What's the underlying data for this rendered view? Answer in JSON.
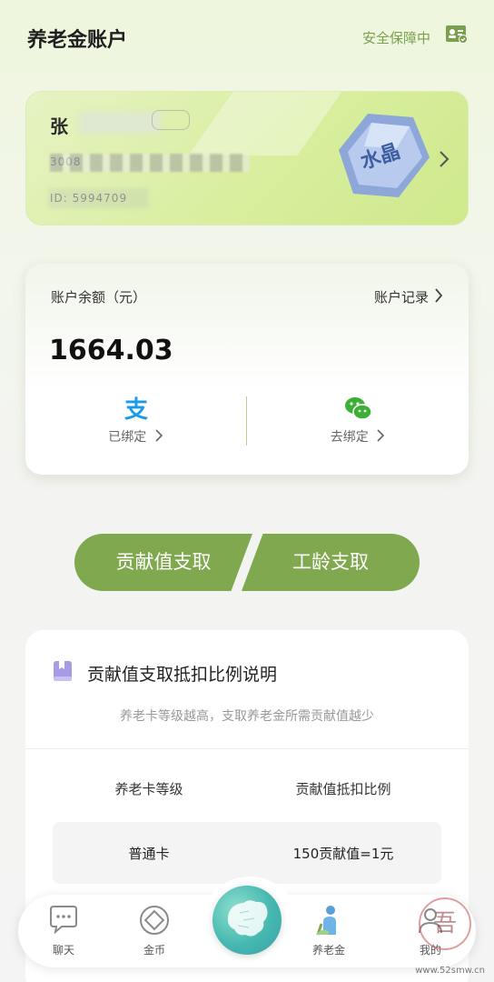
{
  "header": {
    "title": "养老金账户",
    "security_text": "安全保障中",
    "security_icon": "id-card-check-icon"
  },
  "card": {
    "name": "张",
    "number_masked": "3008",
    "id_masked": "ID: 5994709",
    "crystal_label": "水晶",
    "arrow_icon": "chevron-right-icon"
  },
  "balance": {
    "label": "账户余额（元）",
    "record_label": "账户记录",
    "amount": "1664.03",
    "alipay": {
      "icon": "alipay-icon",
      "status": "已绑定"
    },
    "wechat": {
      "icon": "wechat-icon",
      "status": "去绑定"
    }
  },
  "actions": {
    "contribution_withdraw": "贡献值支取",
    "seniority_withdraw": "工龄支取"
  },
  "info": {
    "title": "贡献值支取抵扣比例说明",
    "subtitle": "养老卡等级越高，支取养老金所需贡献值越少",
    "table": {
      "headers": [
        "养老卡等级",
        "贡献值抵扣比例"
      ],
      "rows": [
        [
          "普通卡",
          "150贡献值=1元"
        ]
      ]
    }
  },
  "nav": {
    "items": [
      {
        "label": "聊天",
        "icon": "chat-bubble-icon"
      },
      {
        "label": "金币",
        "icon": "coin-icon"
      },
      {
        "label": "",
        "icon": "china-map-icon"
      },
      {
        "label": "养老金",
        "icon": "elderly-person-icon"
      },
      {
        "label": "我的",
        "icon": "profile-icon"
      }
    ]
  },
  "watermark": "www.52smw.cn",
  "colors": {
    "accent": "#7fa84f",
    "security": "#7aa04d",
    "card_green": "#d8ee9e"
  }
}
